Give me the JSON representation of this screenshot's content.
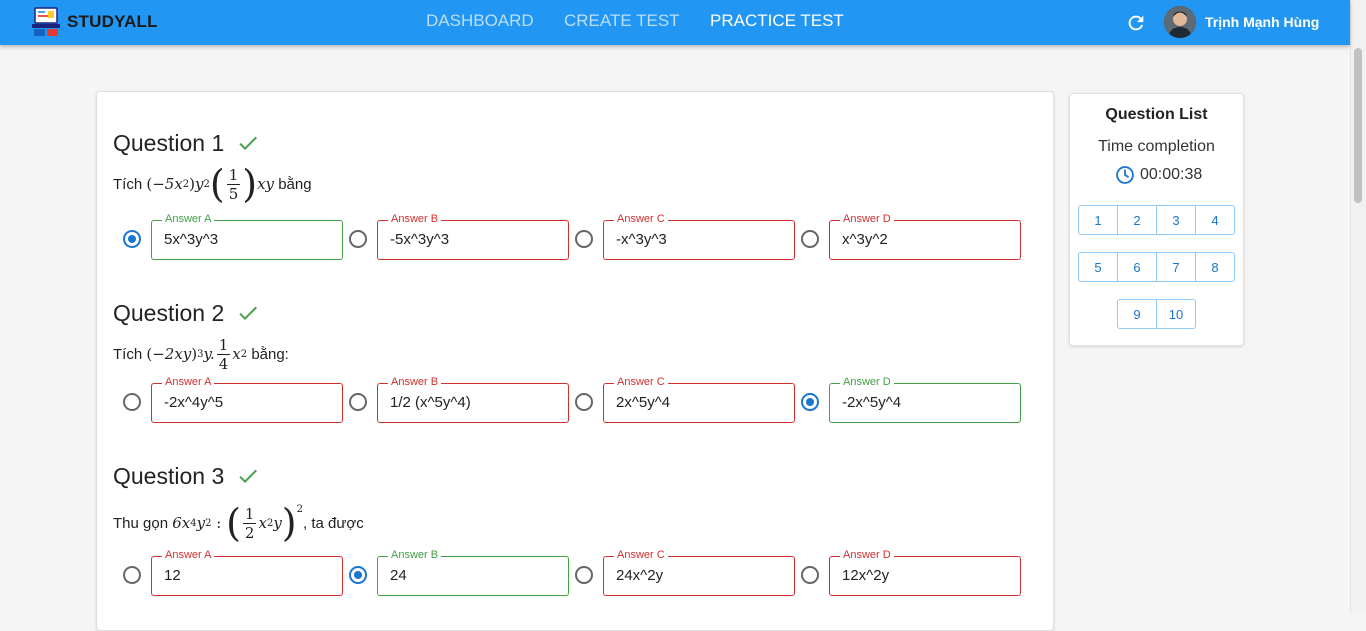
{
  "app": {
    "brand": "STUDYALL",
    "user_name": "Trịnh Mạnh Hùng"
  },
  "nav": {
    "dashboard": "DASHBOARD",
    "create_test": "CREATE TEST",
    "practice_test": "PRACTICE TEST"
  },
  "questions": [
    {
      "title": "Question 1",
      "prefix": "Tích",
      "suffix": "bằng",
      "answers": [
        {
          "label": "Answer A",
          "value": "5x^3y^3",
          "selected": true,
          "correct": true
        },
        {
          "label": "Answer B",
          "value": "-5x^3y^3",
          "selected": false,
          "correct": false
        },
        {
          "label": "Answer C",
          "value": "-x^3y^3",
          "selected": false,
          "correct": false
        },
        {
          "label": "Answer D",
          "value": "x^3y^2",
          "selected": false,
          "correct": false
        }
      ]
    },
    {
      "title": "Question 2",
      "prefix": "Tích",
      "suffix": "bằng:",
      "answers": [
        {
          "label": "Answer A",
          "value": "-2x^4y^5",
          "selected": false,
          "correct": false
        },
        {
          "label": "Answer B",
          "value": "1/2 (x^5y^4)",
          "selected": false,
          "correct": false
        },
        {
          "label": "Answer C",
          "value": "2x^5y^4",
          "selected": false,
          "correct": false
        },
        {
          "label": "Answer D",
          "value": "-2x^5y^4",
          "selected": true,
          "correct": true
        }
      ]
    },
    {
      "title": "Question 3",
      "prefix": "Thu gọn",
      "suffix": ", ta được",
      "answers": [
        {
          "label": "Answer A",
          "value": "12",
          "selected": false,
          "correct": false
        },
        {
          "label": "Answer B",
          "value": "24",
          "selected": true,
          "correct": true
        },
        {
          "label": "Answer C",
          "value": "24x^2y",
          "selected": false,
          "correct": false
        },
        {
          "label": "Answer D",
          "value": "12x^2y",
          "selected": false,
          "correct": false
        }
      ]
    }
  ],
  "sidebar": {
    "title": "Question List",
    "time_label": "Time completion",
    "time_value": "00:00:38",
    "numbers": [
      "1",
      "2",
      "3",
      "4",
      "5",
      "6",
      "7",
      "8",
      "9",
      "10"
    ]
  },
  "colors": {
    "appbar": "#2196f3",
    "correct": "#43a047",
    "wrong": "#d32f2f",
    "radio_on": "#1976d2"
  },
  "icons": {
    "logo": "book-laptop-icon",
    "refresh": "refresh-icon",
    "check": "check-icon",
    "clock": "clock-icon"
  }
}
